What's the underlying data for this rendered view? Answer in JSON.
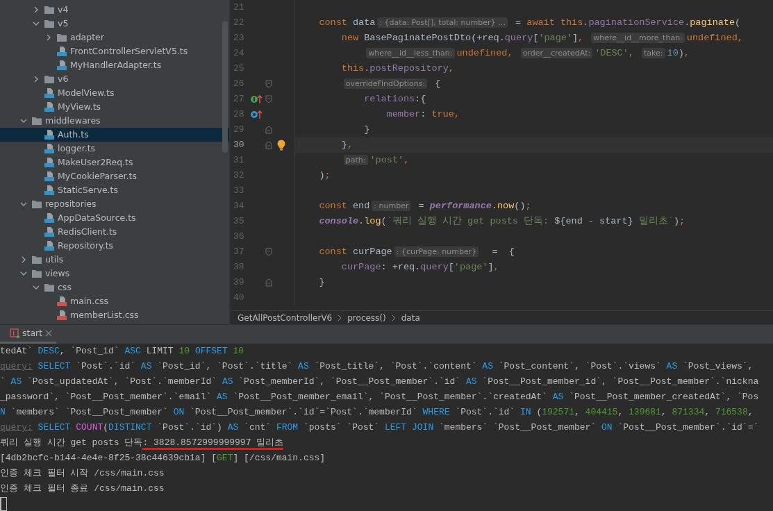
{
  "project_tree": {
    "items": [
      {
        "label": "v4",
        "kind": "folder",
        "expanded": false,
        "selected": false
      },
      {
        "label": "v5",
        "kind": "folder",
        "expanded": true,
        "selected": false,
        "children": [
          {
            "label": "adapter",
            "kind": "folder",
            "expanded": false,
            "selected": false
          },
          {
            "label": "FrontControllerServletV5.ts",
            "kind": "ts",
            "selected": false
          },
          {
            "label": "MyHandlerAdapter.ts",
            "kind": "ts",
            "selected": false
          }
        ]
      },
      {
        "label": "v6",
        "kind": "folder",
        "expanded": false,
        "selected": false
      },
      {
        "label": "ModelView.ts",
        "kind": "ts",
        "selected": false
      },
      {
        "label": "MyView.ts",
        "kind": "ts",
        "selected": false
      }
    ],
    "outer": [
      {
        "label": "middlewares",
        "kind": "folder",
        "expanded": true,
        "selected": false,
        "children": [
          {
            "label": "Auth.ts",
            "kind": "ts",
            "selected": true
          },
          {
            "label": "logger.ts",
            "kind": "ts",
            "selected": false
          },
          {
            "label": "MakeUser2Req.ts",
            "kind": "ts",
            "selected": false
          },
          {
            "label": "MyCookieParser.ts",
            "kind": "ts",
            "selected": false
          },
          {
            "label": "StaticServe.ts",
            "kind": "ts",
            "selected": false
          }
        ]
      },
      {
        "label": "repositories",
        "kind": "folder",
        "expanded": true,
        "selected": false,
        "children": [
          {
            "label": "AppDataSource.ts",
            "kind": "ts",
            "selected": false
          },
          {
            "label": "RedisClient.ts",
            "kind": "ts",
            "selected": false
          },
          {
            "label": "Repository.ts",
            "kind": "ts",
            "selected": false
          }
        ]
      },
      {
        "label": "utils",
        "kind": "folder",
        "expanded": false,
        "selected": false
      },
      {
        "label": "views",
        "kind": "folder",
        "expanded": true,
        "selected": false,
        "children": [
          {
            "label": "css",
            "kind": "folder",
            "expanded": true,
            "selected": false,
            "children": [
              {
                "label": "main.css",
                "kind": "css",
                "selected": false
              },
              {
                "label": "memberList.css",
                "kind": "css",
                "selected": false
              }
            ]
          }
        ]
      }
    ]
  },
  "editor": {
    "lines": [
      {
        "number": "21"
      },
      {
        "number": "22",
        "tokens": [
          {
            "kind": "kw",
            "text": "const "
          },
          {
            "kind": "plain",
            "text": "data"
          },
          {
            "kind": "hint",
            "text": ": {data: Post[], total: number} …"
          },
          {
            "kind": "plain",
            "text": " = "
          },
          {
            "kind": "kw",
            "text": "await this"
          },
          {
            "kind": "plain",
            "text": "."
          },
          {
            "kind": "field",
            "text": "paginationService"
          },
          {
            "kind": "plain",
            "text": "."
          },
          {
            "kind": "method",
            "text": "paginate"
          },
          {
            "kind": "plain",
            "text": "("
          }
        ],
        "children": [
          {
            "number": "23",
            "tokens": [
              {
                "kind": "kw",
                "text": "new "
              },
              {
                "kind": "plain",
                "text": "BasePaginatePostDto(+req."
              },
              {
                "kind": "field",
                "text": "query"
              },
              {
                "kind": "plain",
                "text": "["
              },
              {
                "kind": "str",
                "text": "'page'"
              },
              {
                "kind": "plain",
                "text": "]"
              },
              {
                "kind": "punct",
                "text": ", "
              },
              {
                "kind": "hint",
                "text": "where__id__more_than:"
              },
              {
                "kind": "kw",
                "text": "undefined"
              },
              {
                "kind": "punct",
                "text": ","
              }
            ],
            "children": [
              {
                "number": "24",
                "tokens": [
                  {
                    "kind": "hint",
                    "text": "where__id__less_than:"
                  },
                  {
                    "kind": "kw",
                    "text": "undefined"
                  },
                  {
                    "kind": "punct",
                    "text": ", "
                  },
                  {
                    "kind": "hint",
                    "text": "order__createdAt:"
                  },
                  {
                    "kind": "str",
                    "text": "'DESC'"
                  },
                  {
                    "kind": "punct",
                    "text": ", "
                  },
                  {
                    "kind": "hint",
                    "text": "take:"
                  },
                  {
                    "kind": "num",
                    "text": "10"
                  },
                  {
                    "kind": "plain",
                    "text": ")"
                  },
                  {
                    "kind": "punct",
                    "text": ","
                  }
                ]
              }
            ]
          },
          {
            "number": "25",
            "tokens": [
              {
                "kind": "kw",
                "text": "this"
              },
              {
                "kind": "plain",
                "text": "."
              },
              {
                "kind": "field",
                "text": "postRepository"
              },
              {
                "kind": "punct",
                "text": ","
              }
            ]
          },
          {
            "number": "26",
            "fold_start": true,
            "tokens": [
              {
                "kind": "hint",
                "text": "overrideFindOptions:"
              },
              {
                "kind": "plain",
                "text": " {"
              }
            ],
            "children": [
              {
                "number": "27",
                "fold_start": true,
                "implemented": true,
                "tokens": [
                  {
                    "kind": "field",
                    "text": "relations"
                  },
                  {
                    "kind": "plain",
                    "text": ":{"
                  }
                ],
                "children": [
                  {
                    "number": "28",
                    "overriding": true,
                    "tokens": [
                      {
                        "kind": "field",
                        "text": "member"
                      },
                      {
                        "kind": "plain",
                        "text": ": "
                      },
                      {
                        "kind": "kw",
                        "text": "true"
                      },
                      {
                        "kind": "punct",
                        "text": ","
                      }
                    ]
                  }
                ]
              },
              {
                "number": "29",
                "fold_end": true,
                "tokens": [
                  {
                    "kind": "plain",
                    "text": "}"
                  }
                ]
              }
            ]
          },
          {
            "number": "30",
            "fold_end": true,
            "current": true,
            "bulb": true,
            "tokens": [
              {
                "kind": "plain",
                "text": "}"
              },
              {
                "kind": "punct",
                "text": ","
              }
            ]
          },
          {
            "number": "31",
            "tokens": [
              {
                "kind": "hint",
                "text": "path:"
              },
              {
                "kind": "str",
                "text": "'post'"
              },
              {
                "kind": "punct",
                "text": ","
              }
            ]
          }
        ]
      },
      {
        "number": "32",
        "tokens": [
          {
            "kind": "plain",
            "text": ")"
          },
          {
            "kind": "punct",
            "text": ";"
          }
        ]
      },
      {
        "number": "33"
      },
      {
        "number": "34",
        "tokens": [
          {
            "kind": "kw",
            "text": "const "
          },
          {
            "kind": "plain",
            "text": "end"
          },
          {
            "kind": "hint",
            "text": ": number"
          },
          {
            "kind": "plain",
            "text": " = "
          },
          {
            "kind": "global",
            "text": "performance"
          },
          {
            "kind": "plain",
            "text": "."
          },
          {
            "kind": "method",
            "text": "now"
          },
          {
            "kind": "plain",
            "text": "()"
          },
          {
            "kind": "punct",
            "text": ";"
          }
        ]
      },
      {
        "number": "35",
        "tokens": [
          {
            "kind": "global",
            "text": "console"
          },
          {
            "kind": "plain",
            "text": "."
          },
          {
            "kind": "method",
            "text": "log"
          },
          {
            "kind": "plain",
            "text": "("
          },
          {
            "kind": "str",
            "text": "`쿼리 실행 시간 get posts 단독: "
          },
          {
            "kind": "plain",
            "text": "${end - start}"
          },
          {
            "kind": "str",
            "text": " 밀리초`"
          },
          {
            "kind": "plain",
            "text": ")"
          },
          {
            "kind": "punct",
            "text": ";"
          }
        ]
      },
      {
        "number": "36"
      },
      {
        "number": "37",
        "fold_start": true,
        "tokens": [
          {
            "kind": "kw",
            "text": "const "
          },
          {
            "kind": "plain",
            "text": "curPage"
          },
          {
            "kind": "hint",
            "text": ": {curPage: number}"
          },
          {
            "kind": "plain",
            "text": "  =  {"
          }
        ],
        "children": [
          {
            "number": "38",
            "tokens": [
              {
                "kind": "field",
                "text": "curPage"
              },
              {
                "kind": "plain",
                "text": ": +req."
              },
              {
                "kind": "field",
                "text": "query"
              },
              {
                "kind": "plain",
                "text": "["
              },
              {
                "kind": "str",
                "text": "'page'"
              },
              {
                "kind": "plain",
                "text": "]"
              },
              {
                "kind": "punct",
                "text": ","
              }
            ]
          }
        ]
      },
      {
        "number": "39",
        "fold_end": true,
        "tokens": [
          {
            "kind": "plain",
            "text": "}"
          }
        ]
      },
      {
        "number": "40"
      }
    ]
  },
  "breadcrumb": [
    "GetAllPostControllerV6",
    "process()",
    "data"
  ],
  "run_tabs": [
    {
      "label": "start",
      "selected": true
    }
  ],
  "console": {
    "lines": [
      [
        {
          "kind": "plain",
          "text": "tedAt` "
        },
        {
          "kind": "kw",
          "text": "DESC"
        },
        {
          "kind": "plain",
          "text": ", `Post_id` "
        },
        {
          "kind": "kw",
          "text": "ASC"
        },
        {
          "kind": "plain",
          "text": " LIMIT "
        },
        {
          "kind": "num",
          "text": "10"
        },
        {
          "kind": "kw",
          "text": " OFFSET "
        },
        {
          "kind": "num",
          "text": "10"
        }
      ],
      [
        {
          "kind": "label",
          "text": "query:"
        },
        {
          "kind": "kw",
          "text": " SELECT"
        },
        {
          "kind": "plain",
          "text": " `Post`.`id` "
        },
        {
          "kind": "kw",
          "text": "AS"
        },
        {
          "kind": "plain",
          "text": " `Post_id`, `Post`.`title` "
        },
        {
          "kind": "kw",
          "text": "AS"
        },
        {
          "kind": "plain",
          "text": " `Post_title`, `Post`.`content` "
        },
        {
          "kind": "kw",
          "text": "AS"
        },
        {
          "kind": "plain",
          "text": " `Post_content`, `Post`.`views` "
        },
        {
          "kind": "kw",
          "text": "AS"
        },
        {
          "kind": "plain",
          "text": " `Post_views`,"
        }
      ],
      [
        {
          "kind": "plain",
          "text": "` "
        },
        {
          "kind": "kw",
          "text": "AS"
        },
        {
          "kind": "plain",
          "text": " `Post_updatedAt`, `Post`.`memberId` "
        },
        {
          "kind": "kw",
          "text": "AS"
        },
        {
          "kind": "plain",
          "text": " `Post_memberId`, `Post__Post_member`.`id` "
        },
        {
          "kind": "kw",
          "text": "AS"
        },
        {
          "kind": "plain",
          "text": " `Post__Post_member_id`, `Post__Post_member`.`nickna"
        }
      ],
      [
        {
          "kind": "plain",
          "text": "_password`, `Post__Post_member`.`email` "
        },
        {
          "kind": "kw",
          "text": "AS"
        },
        {
          "kind": "plain",
          "text": " `Post__Post_member_email`, `Post__Post_member`.`createdAt` "
        },
        {
          "kind": "kw",
          "text": "AS"
        },
        {
          "kind": "plain",
          "text": " `Post__Post_member_createdAt`, `Pos"
        }
      ],
      [
        {
          "kind": "kw",
          "text": "N"
        },
        {
          "kind": "plain",
          "text": " `members` `Post__Post_member` "
        },
        {
          "kind": "kw",
          "text": "ON"
        },
        {
          "kind": "plain",
          "text": " `Post__Post_member`.`id`=`Post`.`memberId` "
        },
        {
          "kind": "kw",
          "text": "WHERE"
        },
        {
          "kind": "plain",
          "text": " `Post`.`id` "
        },
        {
          "kind": "kw",
          "text": "IN"
        },
        {
          "kind": "plain",
          "text": " ("
        },
        {
          "kind": "num",
          "text": "192571"
        },
        {
          "kind": "plain",
          "text": ", "
        },
        {
          "kind": "num",
          "text": "404415"
        },
        {
          "kind": "plain",
          "text": ", "
        },
        {
          "kind": "num",
          "text": "139681"
        },
        {
          "kind": "plain",
          "text": ", "
        },
        {
          "kind": "num",
          "text": "871334"
        },
        {
          "kind": "plain",
          "text": ", "
        },
        {
          "kind": "num",
          "text": "716538"
        },
        {
          "kind": "plain",
          "text": ","
        }
      ],
      [
        {
          "kind": "label",
          "text": "query:"
        },
        {
          "kind": "kw",
          "text": " SELECT "
        },
        {
          "kind": "fn",
          "text": "COUNT"
        },
        {
          "kind": "plain",
          "text": "("
        },
        {
          "kind": "kw",
          "text": "DISTINCT"
        },
        {
          "kind": "plain",
          "text": " `Post`.`id`) "
        },
        {
          "kind": "kw",
          "text": "AS"
        },
        {
          "kind": "plain",
          "text": " `cnt` "
        },
        {
          "kind": "kw",
          "text": "FROM"
        },
        {
          "kind": "plain",
          "text": " `posts` `Post` "
        },
        {
          "kind": "kw",
          "text": "LEFT JOIN"
        },
        {
          "kind": "plain",
          "text": " `members` `Post__Post_member` "
        },
        {
          "kind": "kw",
          "text": "ON"
        },
        {
          "kind": "plain",
          "text": " `Post__Post_member`.`id`=`"
        }
      ],
      [
        {
          "kind": "plain",
          "text": "쿼리 실행 시간 get posts 단독"
        },
        {
          "kind": "underlined",
          "text": ": 3828.8572999999997 밀리초"
        }
      ],
      [
        {
          "kind": "plain",
          "text": "[4db2bcfc-b144-4e4e-8f25-38c44639cb1a] ["
        },
        {
          "kind": "num",
          "text": "GET"
        },
        {
          "kind": "plain",
          "text": "] [/css/main.css]"
        }
      ],
      [
        {
          "kind": "plain",
          "text": "인증 체크 필터 시작 /css/main.css"
        }
      ],
      [
        {
          "kind": "plain",
          "text": "인증 체크 필터 종료 /css/main.css"
        }
      ]
    ]
  }
}
